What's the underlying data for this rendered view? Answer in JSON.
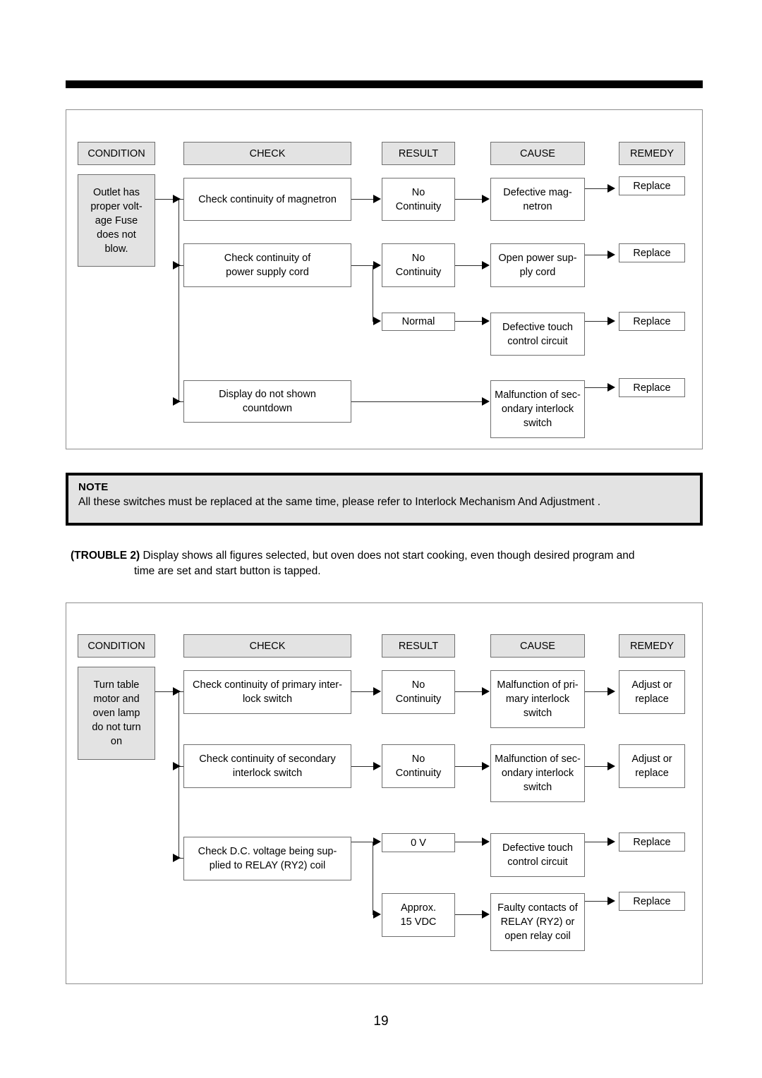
{
  "page": {
    "number": "19"
  },
  "note": {
    "title": "NOTE",
    "text": "All these switches must be replaced at the same time, please refer to  Interlock Mechanism And Adjustment ."
  },
  "trouble": {
    "label": "(TROUBLE 2)",
    "line1": "Display shows all figures selected, but oven does not start cooking, even though desired program and",
    "line2": "time are set and start button is tapped."
  },
  "colors": {
    "header_fill": "#e3e3e3",
    "box_border": "#6e6e6e",
    "line": "#2b2b2b",
    "rule": "#000000"
  },
  "chart_data": [
    {
      "id": "trouble1",
      "type": "flowchart",
      "headers": [
        "CONDITION",
        "CHECK",
        "RESULT",
        "CAUSE",
        "REMEDY"
      ],
      "condition": "Outlet has\nproper volt-\nage Fuse\ndoes not\nblow.",
      "rows": [
        {
          "check": "Check continuity of magnetron",
          "result": "No\nContinuity",
          "cause": "Defective mag-\nnetron",
          "remedy": "Replace"
        },
        {
          "check": "Check continuity of\npower supply cord",
          "result": "No\nContinuity",
          "cause": "Open power sup-\nply cord",
          "remedy": "Replace"
        },
        {
          "check": "",
          "result": "Normal",
          "cause": "Defective touch\ncontrol circuit",
          "remedy": "Replace"
        },
        {
          "check": "Display do not shown\ncountdown",
          "result": "",
          "cause": "Malfunction of sec-\nondary interlock\nswitch",
          "remedy": "Replace"
        }
      ]
    },
    {
      "id": "trouble2",
      "type": "flowchart",
      "headers": [
        "CONDITION",
        "CHECK",
        "RESULT",
        "CAUSE",
        "REMEDY"
      ],
      "condition": "Turn table\nmotor and\noven lamp\ndo not turn\non",
      "rows": [
        {
          "check": "Check continuity of primary inter-\nlock switch",
          "result": "No\nContinuity",
          "cause": "Malfunction of pri-\nmary interlock\nswitch",
          "remedy": "Adjust or\nreplace"
        },
        {
          "check": "Check continuity of secondary\ninterlock switch",
          "result": "No\nContinuity",
          "cause": "Malfunction of sec-\nondary interlock\nswitch",
          "remedy": "Adjust or\nreplace"
        },
        {
          "check": "Check D.C. voltage being sup-\nplied to RELAY (RY2) coil",
          "result": "0 V",
          "cause": "Defective touch\ncontrol circuit",
          "remedy": "Replace"
        },
        {
          "check": "",
          "result": "Approx.\n15 VDC",
          "cause": "Faulty contacts of\nRELAY (RY2) or\nopen relay coil",
          "remedy": "Replace"
        }
      ]
    }
  ]
}
